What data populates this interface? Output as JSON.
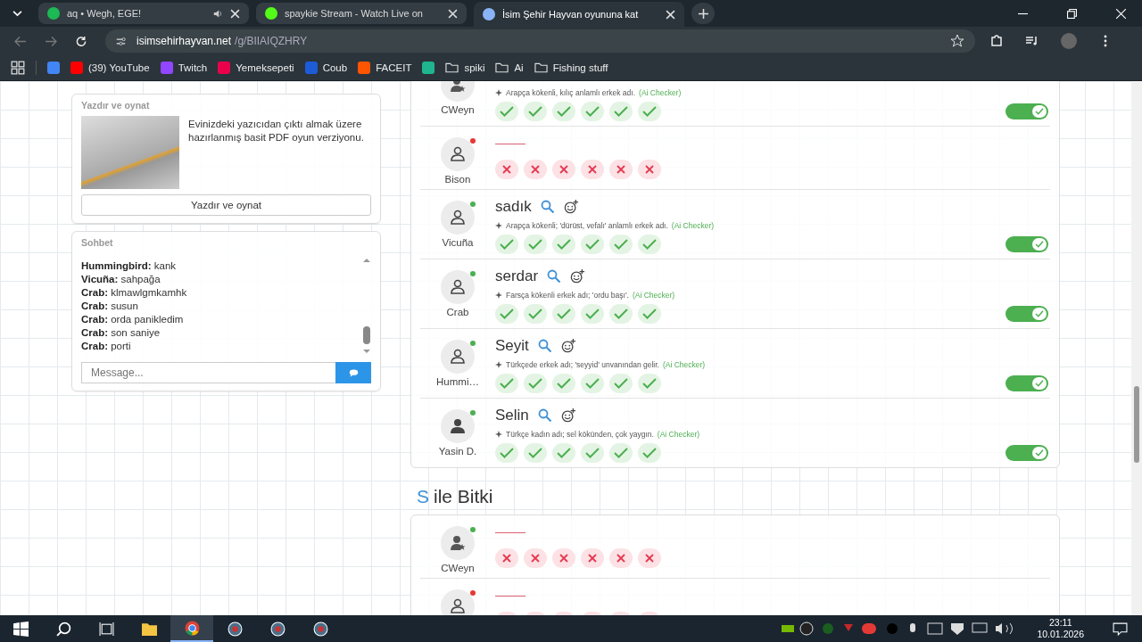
{
  "browser": {
    "tabs": [
      {
        "title": "aq • Wegh, EGE!",
        "color": "#1db954",
        "audio": true,
        "selected": false
      },
      {
        "title": "spaykie Stream - Watch Live on",
        "color": "#53fc18",
        "audio": false,
        "selected": false
      },
      {
        "title": "İsim Şehir Hayvan oyununa kat",
        "color": "#8ab4f8",
        "audio": false,
        "selected": true
      }
    ],
    "url": {
      "domain": "isimsehirhayvan.net",
      "path": "/g/BIIAIQZHRY"
    },
    "bookmarks": [
      {
        "kind": "site",
        "color": "#4285f4"
      },
      {
        "kind": "site",
        "label": "(39) YouTube",
        "color": "#ff0000"
      },
      {
        "kind": "site",
        "label": "Twitch",
        "color": "#9146ff"
      },
      {
        "kind": "site",
        "label": "Yemeksepeti",
        "color": "#ea004b"
      },
      {
        "kind": "site",
        "label": "Coub",
        "color": "#1e5bd6"
      },
      {
        "kind": "site",
        "label": "FACEIT",
        "color": "#ff5500"
      },
      {
        "kind": "site",
        "color": "#1fb58f"
      },
      {
        "kind": "folder",
        "label": "spiki"
      },
      {
        "kind": "folder",
        "label": "Ai"
      },
      {
        "kind": "folder",
        "label": "Fishing stuff"
      }
    ]
  },
  "print_card": {
    "title": "Yazdır ve oynat",
    "text": "Evinizdeki yazıcıdan çıktı almak üzere hazırlanmış basit PDF oyun verziyonu.",
    "button": "Yazdır ve oynat"
  },
  "chat": {
    "title": "Sohbet",
    "messages": [
      {
        "author": "Hummingbird:",
        "text": "kank"
      },
      {
        "author": "Vicuña:",
        "text": "sahpağa"
      },
      {
        "author": "Crab:",
        "text": "klmawlgmkamhk"
      },
      {
        "author": "Crab:",
        "text": "susun"
      },
      {
        "author": "Crab:",
        "text": "orda panikledim"
      },
      {
        "author": "Crab:",
        "text": "son saniye"
      },
      {
        "author": "Crab:",
        "text": "porti"
      }
    ],
    "placeholder": "Message..."
  },
  "sections": [
    {
      "rows": [
        {
          "player": "CWeyn",
          "avatar": {
            "kind": "host"
          },
          "kind": "answered",
          "description": "Arapça kökenli, kılıç anlamlı erkek adı.",
          "source": "(Ai Checker)",
          "votes": [
            true,
            true,
            true,
            true,
            true,
            true
          ],
          "accepted": true
        },
        {
          "player": "Bison",
          "avatar": {
            "kind": "outline"
          },
          "color": "#e53935",
          "kind": "blank",
          "votes": [
            false,
            false,
            false,
            false,
            false,
            false
          ]
        },
        {
          "player": "Vicuña",
          "avatar": {
            "kind": "outline"
          },
          "color": "#4caf50",
          "kind": "answered",
          "word": "sadık",
          "description": "Arapça kökenli; 'dürüst, vefalı' anlamlı erkek adı.",
          "source": "(Ai Checker)",
          "votes": [
            true,
            true,
            true,
            true,
            true,
            true
          ],
          "accepted": true
        },
        {
          "player": "Crab",
          "avatar": {
            "kind": "outline"
          },
          "color": "#4caf50",
          "kind": "answered",
          "word": "serdar",
          "description": "Farsça kökenli erkek adı; 'ordu başı'.",
          "source": "(Ai Checker)",
          "votes": [
            true,
            true,
            true,
            true,
            true,
            true
          ],
          "accepted": true
        },
        {
          "player": "Hummi…",
          "avatar": {
            "kind": "outline"
          },
          "color": "#4caf50",
          "kind": "answered",
          "word": "Seyit",
          "description": "Türkçede erkek adı; 'seyyid' unvanından gelir.",
          "source": "(Ai Checker)",
          "votes": [
            true,
            true,
            true,
            true,
            true,
            true
          ],
          "accepted": true
        },
        {
          "player": "Yasin D.",
          "avatar": {
            "kind": "filled"
          },
          "color": "#4caf50",
          "kind": "answered",
          "word": "Selin",
          "description": "Türkçe kadın adı; sel kökünden, çok yaygın.",
          "source": "(Ai Checker)",
          "votes": [
            true,
            true,
            true,
            true,
            true,
            true
          ],
          "accepted": true
        }
      ]
    },
    {
      "letter": "S",
      "title": "ile Bitki",
      "rows": [
        {
          "player": "CWeyn",
          "avatar": {
            "kind": "host"
          },
          "color": "#4caf50",
          "kind": "blank",
          "votes": [
            false,
            false,
            false,
            false,
            false,
            false
          ]
        },
        {
          "avatar": {
            "kind": "outline"
          },
          "color": "#e53935",
          "kind": "blank",
          "votes": [
            false,
            false,
            false,
            false,
            false,
            false
          ]
        }
      ]
    }
  ],
  "taskbar": {
    "apps": [
      {
        "kind": "search",
        "selected": false
      },
      {
        "kind": "taskview",
        "selected": false
      },
      {
        "kind": "explorer",
        "selected": false
      },
      {
        "kind": "chrome",
        "selected": true
      },
      {
        "kind": "app",
        "selected": false
      },
      {
        "kind": "app",
        "selected": false
      },
      {
        "kind": "app",
        "selected": false
      }
    ],
    "time": "23:11",
    "date": "10.01.2026"
  }
}
